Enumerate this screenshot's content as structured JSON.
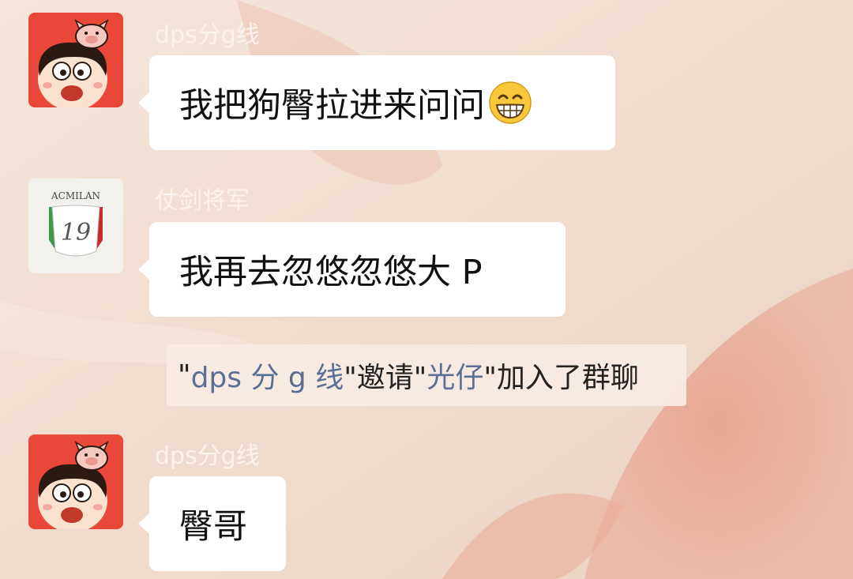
{
  "messages": [
    {
      "sender": "dps分g线",
      "text": "我把狗臀拉进来问问",
      "emoji": "grinning-face-emoji",
      "avatar": "cartoon-kid-pig-avatar"
    },
    {
      "sender": "仗剑将军",
      "text": "我再去忽悠忽悠大 P",
      "avatar": "acmilan-19-avatar",
      "avatar_text": "ACMILAN",
      "avatar_number": "19"
    },
    {
      "sender": "dps分g线",
      "text": "臀哥",
      "avatar": "cartoon-kid-pig-avatar"
    }
  ],
  "system_message": {
    "q1": "\"",
    "inviter": "dps 分 g 线",
    "q2": "\"邀请\"",
    "invitee": "光仔",
    "tail": "\"加入了群聊"
  },
  "colors": {
    "background": "#f1dccd",
    "bubble": "#ffffff",
    "link": "#5a6f93",
    "avatar_red": "#e8473a"
  }
}
